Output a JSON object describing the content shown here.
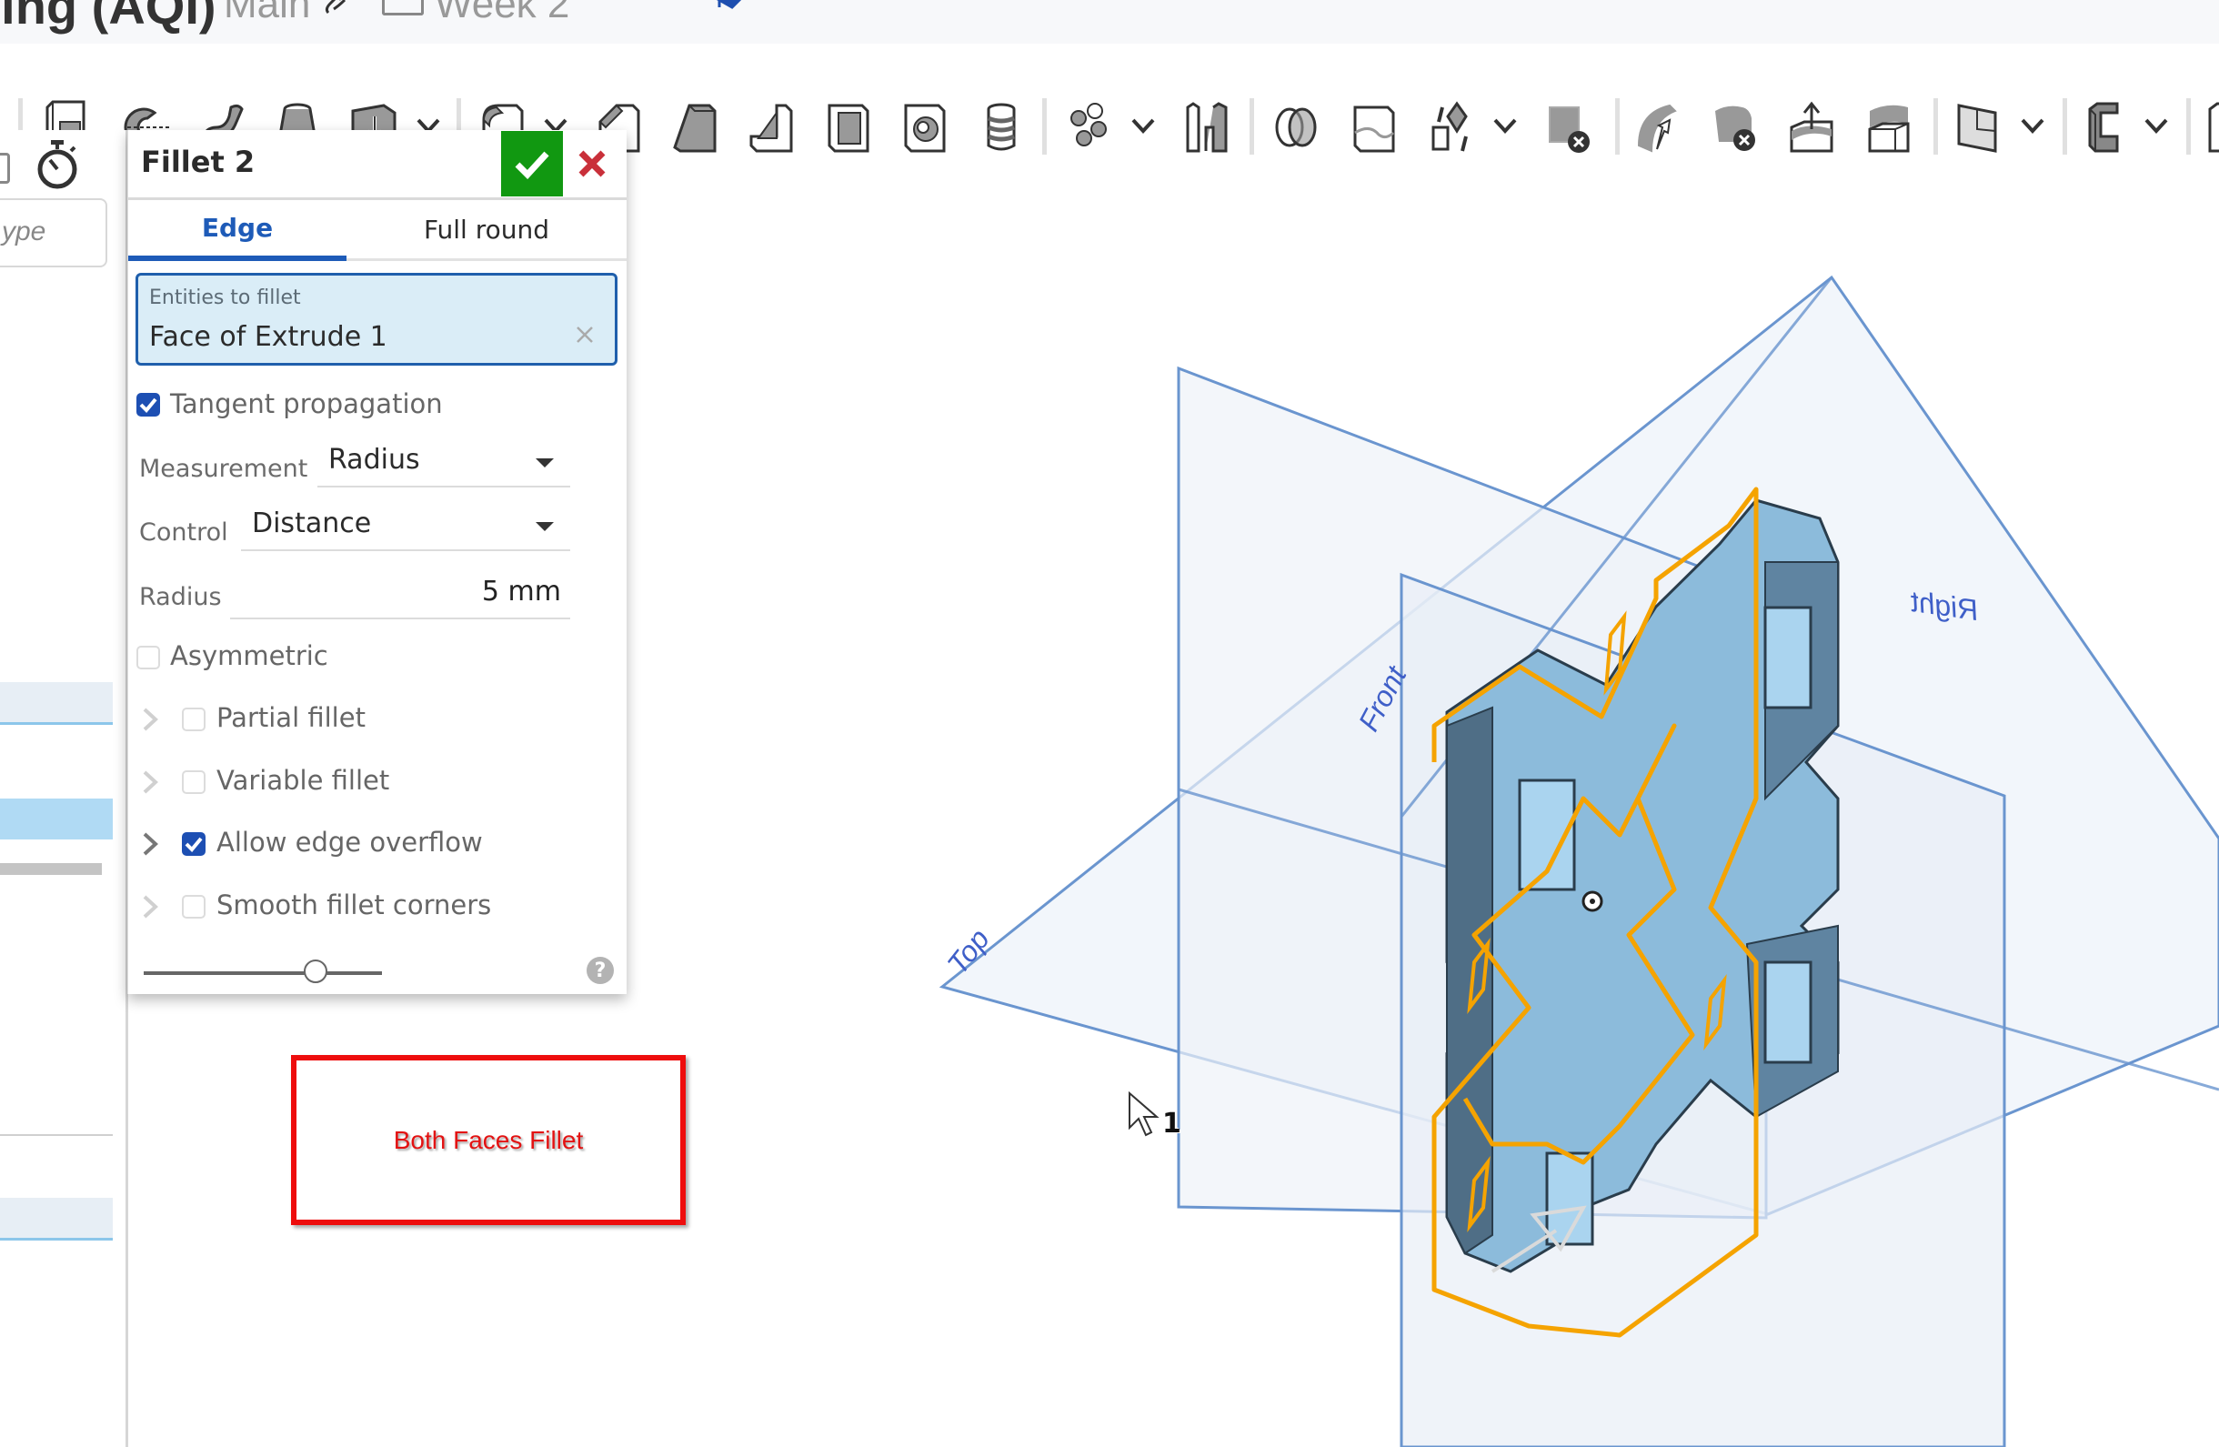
{
  "header": {
    "doc_title": "sing (AQI)",
    "branch": "Main",
    "version_label": "Week 2"
  },
  "toolbar": {
    "items": [
      {
        "icon": "sketch-icon"
      },
      {
        "icon": "revolve-icon"
      },
      {
        "icon": "sweep-icon"
      },
      {
        "icon": "loft-icon"
      },
      {
        "icon": "thicken-icon",
        "has_dropdown": true
      },
      {
        "icon": "fillet-icon",
        "has_dropdown": true
      },
      {
        "icon": "chamfer-icon"
      },
      {
        "icon": "draft-icon"
      },
      {
        "icon": "rib-icon"
      },
      {
        "icon": "shell-icon"
      },
      {
        "icon": "hole-icon"
      },
      {
        "icon": "thread-icon"
      },
      {
        "icon": "pattern-icon",
        "has_dropdown": true
      },
      {
        "icon": "mirror-icon"
      },
      {
        "icon": "boolean-icon"
      },
      {
        "icon": "split-icon"
      },
      {
        "icon": "transform-icon",
        "has_dropdown": true
      },
      {
        "icon": "delete-part-icon"
      },
      {
        "icon": "modify-fillet-icon"
      },
      {
        "icon": "delete-face-icon"
      },
      {
        "icon": "move-face-icon"
      },
      {
        "icon": "replace-face-icon"
      },
      {
        "icon": "plane-icon",
        "has_dropdown": true
      },
      {
        "icon": "sheet-metal-icon",
        "has_dropdown": true
      },
      {
        "icon": "frame-icon"
      }
    ]
  },
  "leftpanel": {
    "search_placeholder": "ype"
  },
  "fillet_dialog": {
    "title": "Fillet 2",
    "tabs": [
      {
        "label": "Edge",
        "active": true
      },
      {
        "label": "Full round",
        "active": false
      }
    ],
    "entities_label": "Entities to fillet",
    "entities_value": "Face of Extrude 1",
    "tangent_propagation": {
      "label": "Tangent propagation",
      "checked": true
    },
    "measurement": {
      "label": "Measurement",
      "value": "Radius"
    },
    "control": {
      "label": "Control",
      "value": "Distance"
    },
    "radius": {
      "label": "Radius",
      "value": "5 mm"
    },
    "asymmetric": {
      "label": "Asymmetric",
      "checked": false
    },
    "options": [
      {
        "label": "Partial fillet",
        "checked": false
      },
      {
        "label": "Variable fillet",
        "checked": false
      },
      {
        "label": "Allow edge overflow",
        "checked": true
      },
      {
        "label": "Smooth fillet corners",
        "checked": false
      }
    ],
    "slider_value": 0.72,
    "help": "?"
  },
  "annotation": {
    "text": "Both Faces Fillet"
  },
  "viewport": {
    "planes": [
      "Top",
      "Front",
      "Right"
    ],
    "cursor_badge": "1",
    "colors": {
      "plane": "#5b8ac8",
      "selection": "#f5a300",
      "part": "#8ab8d8"
    }
  }
}
